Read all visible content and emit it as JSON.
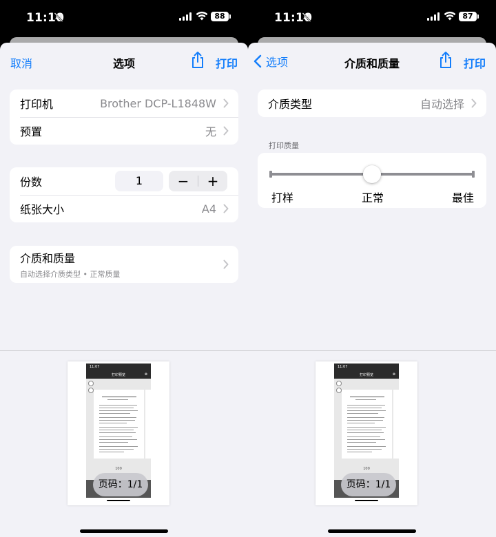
{
  "left": {
    "status": {
      "time": "11:10",
      "battery": "88"
    },
    "nav": {
      "cancel": "取消",
      "title": "选项",
      "print": "打印"
    },
    "printer": {
      "label": "打印机",
      "value": "Brother DCP-L1848W"
    },
    "preset": {
      "label": "预置",
      "value": "无"
    },
    "copies": {
      "label": "份数",
      "value": "1",
      "minus": "−",
      "plus": "+"
    },
    "paper": {
      "label": "纸张大小",
      "value": "A4"
    },
    "media": {
      "label": "介质和质量",
      "sub": "自动选择介质类型 • 正常质量"
    },
    "page_badge": "页码：1/1"
  },
  "right": {
    "status": {
      "time": "11:10",
      "battery": "87"
    },
    "nav": {
      "back": "选项",
      "title": "介质和质量",
      "print": "打印"
    },
    "media_type": {
      "label": "介质类型",
      "value": "自动选择"
    },
    "quality_section": "打印质量",
    "quality": {
      "options": [
        "打样",
        "正常",
        "最佳"
      ],
      "selected_index": 1
    },
    "page_badge": "页码：1/1"
  },
  "preview": {
    "phone_time": "11:07",
    "phone_title": "打印预览",
    "page_number": "100"
  },
  "colors": {
    "accent": "#147efb",
    "background": "#f2f2f7"
  }
}
